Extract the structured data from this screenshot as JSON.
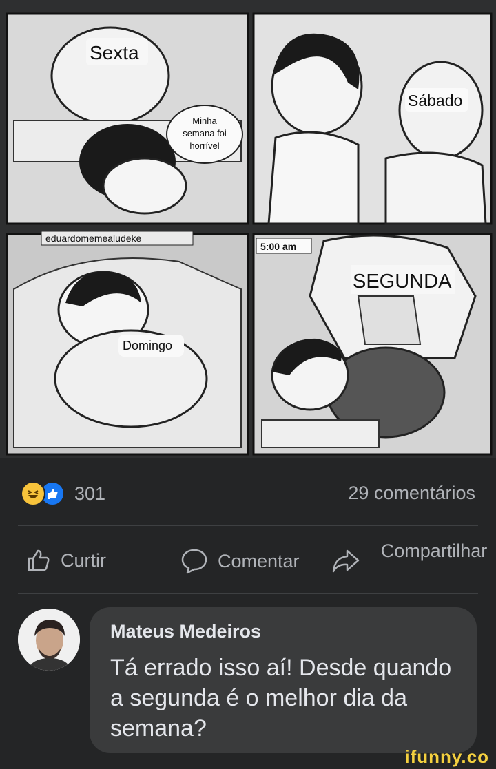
{
  "comic": {
    "panel1_caption": "Sexta",
    "panel1_bubble_line1": "Minha",
    "panel1_bubble_line2": "semana foi",
    "panel1_bubble_line3": "horrível",
    "panel2_caption": "Sábado",
    "panel3_caption": "Domingo",
    "panel4_time": "5:00 am",
    "panel4_caption": "SEGUNDA",
    "credit": "eduardomemealudeke"
  },
  "stats": {
    "reaction_count": "301",
    "comment_count": "29 comentários"
  },
  "actions": {
    "like_label": "Curtir",
    "comment_label": "Comentar",
    "share_label": "Compartilhar"
  },
  "comment": {
    "author": "Mateus Medeiros",
    "text": "Tá errado isso aí! Desde quando a segunda é o melhor dia da semana?"
  },
  "watermark": "ifunny.co"
}
